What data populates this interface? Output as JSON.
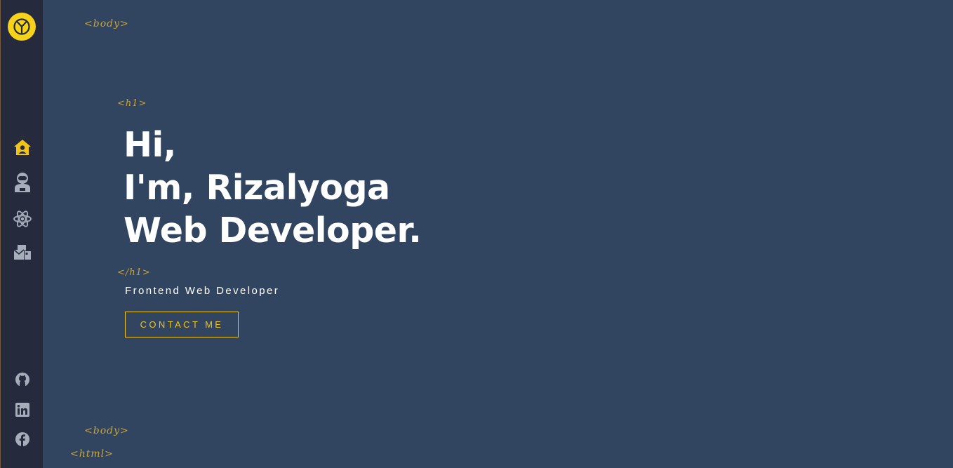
{
  "sidebar": {
    "logo_icon": "peace-sign-logo",
    "nav": [
      {
        "icon": "home-user-icon",
        "active": true
      },
      {
        "icon": "astronaut-icon",
        "active": false
      },
      {
        "icon": "react-atom-icon",
        "active": false
      },
      {
        "icon": "mail-bulk-icon",
        "active": false
      }
    ],
    "social": [
      {
        "icon": "github-icon"
      },
      {
        "icon": "linkedin-icon"
      },
      {
        "icon": "facebook-icon"
      }
    ]
  },
  "tags": {
    "body_open": "<body>",
    "h1_open": "<h1>",
    "h1_close": "</h1>",
    "body_close": "<body>",
    "html_close": "<html>"
  },
  "hero": {
    "line1": "Hi,",
    "line2": "I'm, Rizalyoga",
    "line3": "Web Developer."
  },
  "subtitle": "Frontend Web Developer",
  "contact_button": "CONTACT ME",
  "colors": {
    "background": "#314560",
    "sidebar": "#262a3d",
    "accent": "#f0c419",
    "tag": "#c9a437",
    "icon_inactive": "#a7aebb",
    "text": "#ffffff"
  }
}
